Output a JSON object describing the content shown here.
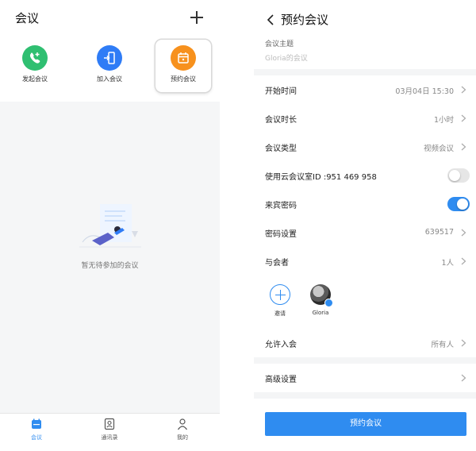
{
  "left": {
    "title": "会议",
    "actions": [
      {
        "label": "发起会议",
        "icon": "phone-plus-icon",
        "color": "#2fbf71"
      },
      {
        "label": "加入会议",
        "icon": "door-enter-icon",
        "color": "#2f7cf6"
      },
      {
        "label": "预约会议",
        "icon": "calendar-icon",
        "color": "#f7911d"
      }
    ],
    "empty_text": "暂无待参加的会议",
    "tabs": [
      {
        "label": "会议",
        "icon": "calendar-icon",
        "active": true
      },
      {
        "label": "通讯录",
        "icon": "contacts-icon",
        "active": false
      },
      {
        "label": "我的",
        "icon": "person-icon",
        "active": false
      }
    ]
  },
  "right": {
    "title": "预约会议",
    "subject_label": "会议主题",
    "subject_placeholder": "Gloria的会议",
    "rows": [
      {
        "label": "开始时间",
        "value": "03月04日 15:30"
      },
      {
        "label": "会议时长",
        "value": "1小时"
      },
      {
        "label": "会议类型",
        "value": "视频会议"
      },
      {
        "label": "使用云会议室ID :951 469 958",
        "toggle": "off"
      },
      {
        "label": "来宾密码",
        "toggle": "on"
      },
      {
        "label": "密码设置",
        "value": "639517"
      },
      {
        "label": "与会者",
        "value": "1人"
      }
    ],
    "invite_label": "邀请",
    "member_name": "Gloria",
    "admit_label": "允许入会",
    "admit_value": "所有人",
    "advanced_label": "高级设置",
    "submit_label": "预约会议"
  },
  "colors": {
    "accent": "#2f8cf0",
    "green": "#2fbf71",
    "orange": "#f7911d"
  }
}
